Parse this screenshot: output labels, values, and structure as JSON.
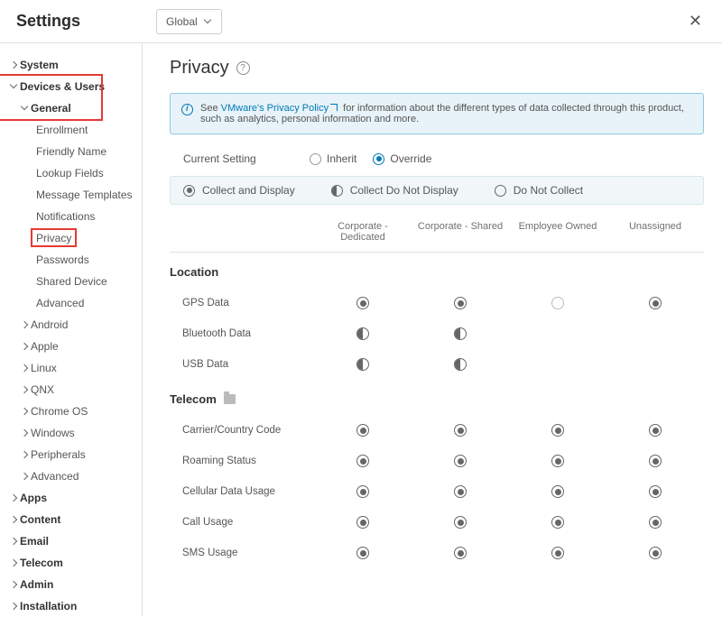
{
  "title": "Settings",
  "scope_label": "Global",
  "sidebar": [
    {
      "label": "System",
      "depth": 0,
      "chev": "right",
      "bold": true
    },
    {
      "label": "Devices & Users",
      "depth": 0,
      "chev": "down",
      "bold": true,
      "hl_group": "g1"
    },
    {
      "label": "General",
      "depth": 1,
      "chev": "down",
      "bold": true,
      "hl_group": "g1"
    },
    {
      "label": "Enrollment",
      "depth": 2
    },
    {
      "label": "Friendly Name",
      "depth": 2
    },
    {
      "label": "Lookup Fields",
      "depth": 2
    },
    {
      "label": "Message Templates",
      "depth": 2
    },
    {
      "label": "Notifications",
      "depth": 2
    },
    {
      "label": "Privacy",
      "depth": 2,
      "hl_group": "g2"
    },
    {
      "label": "Passwords",
      "depth": 2
    },
    {
      "label": "Shared Device",
      "depth": 2
    },
    {
      "label": "Advanced",
      "depth": 2
    },
    {
      "label": "Android",
      "depth": 1,
      "chev": "right"
    },
    {
      "label": "Apple",
      "depth": 1,
      "chev": "right"
    },
    {
      "label": "Linux",
      "depth": 1,
      "chev": "right"
    },
    {
      "label": "QNX",
      "depth": 1,
      "chev": "right"
    },
    {
      "label": "Chrome OS",
      "depth": 1,
      "chev": "right"
    },
    {
      "label": "Windows",
      "depth": 1,
      "chev": "right"
    },
    {
      "label": "Peripherals",
      "depth": 1,
      "chev": "right"
    },
    {
      "label": "Advanced",
      "depth": 1,
      "chev": "right"
    },
    {
      "label": "Apps",
      "depth": 0,
      "chev": "right",
      "bold": true
    },
    {
      "label": "Content",
      "depth": 0,
      "chev": "right",
      "bold": true
    },
    {
      "label": "Email",
      "depth": 0,
      "chev": "right",
      "bold": true
    },
    {
      "label": "Telecom",
      "depth": 0,
      "chev": "right",
      "bold": true
    },
    {
      "label": "Admin",
      "depth": 0,
      "chev": "right",
      "bold": true
    },
    {
      "label": "Installation",
      "depth": 0,
      "chev": "right",
      "bold": true
    }
  ],
  "page": {
    "heading": "Privacy",
    "info_prefix": "See ",
    "info_link": "VMware's Privacy Policy",
    "info_suffix": " for information about the different types of data collected through this product, such as analytics, personal information and more.",
    "current_setting_label": "Current Setting",
    "inherit_label": "Inherit",
    "override_label": "Override",
    "legend": {
      "collect_display": "Collect and Display",
      "collect_no_display": "Collect Do Not Display",
      "no_collect": "Do Not Collect"
    },
    "columns": [
      "Corporate - Dedicated",
      "Corporate - Shared",
      "Employee Owned",
      "Unassigned"
    ],
    "sections": [
      {
        "title": "Location",
        "folder": false,
        "rows": [
          {
            "label": "GPS Data",
            "cells": [
              "full",
              "full",
              "empty",
              "full"
            ]
          },
          {
            "label": "Bluetooth Data",
            "cells": [
              "half",
              "half",
              null,
              null
            ]
          },
          {
            "label": "USB Data",
            "cells": [
              "half",
              "half",
              null,
              null
            ]
          }
        ]
      },
      {
        "title": "Telecom",
        "folder": true,
        "rows": [
          {
            "label": "Carrier/Country Code",
            "cells": [
              "full",
              "full",
              "full",
              "full"
            ]
          },
          {
            "label": "Roaming Status",
            "cells": [
              "full",
              "full",
              "full",
              "full"
            ]
          },
          {
            "label": "Cellular Data Usage",
            "cells": [
              "full",
              "full",
              "full",
              "full"
            ]
          },
          {
            "label": "Call Usage",
            "cells": [
              "full",
              "full",
              "full",
              "full"
            ]
          },
          {
            "label": "SMS Usage",
            "cells": [
              "full",
              "full",
              "full",
              "full"
            ]
          }
        ]
      }
    ]
  }
}
